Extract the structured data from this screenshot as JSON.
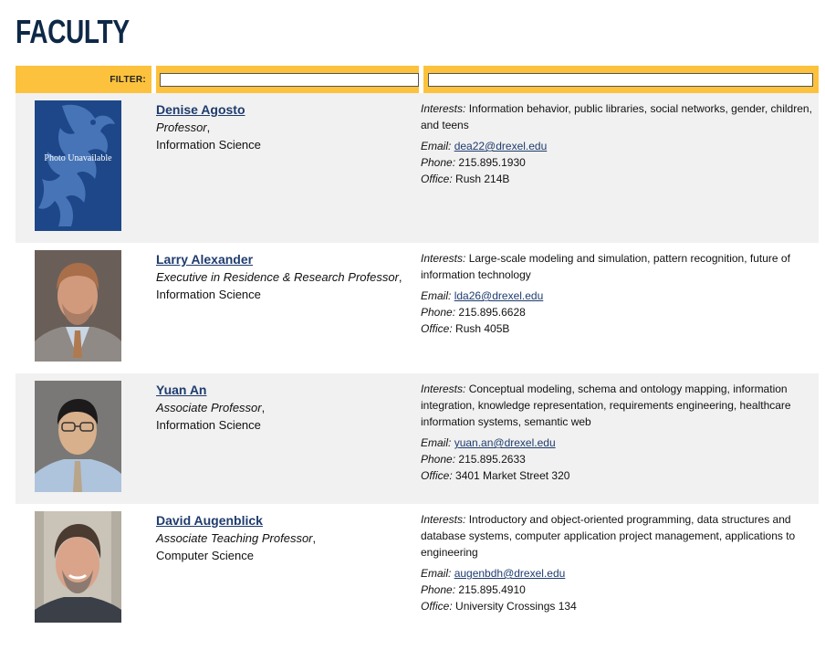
{
  "page": {
    "title": "FACULTY"
  },
  "filter": {
    "label": "FILTER:",
    "name_value": "",
    "interest_value": ""
  },
  "labels": {
    "interests": "Interests:",
    "email": "Email:",
    "phone": "Phone:",
    "office": "Office:",
    "title_separator": ","
  },
  "faculty": [
    {
      "name": "Denise Agosto",
      "title": "Professor",
      "department": "Information Science",
      "interests": "Information behavior, public libraries, social networks, gender, children, and teens",
      "email": "dea22@drexel.edu",
      "phone": "215.895.1930",
      "office": "Rush 214B",
      "photo_text": "Photo Unavailable",
      "photo_colors": {
        "bg": "#1d4788",
        "logo": "#4e7cc0"
      }
    },
    {
      "name": "Larry Alexander",
      "title": "Executive in Residence & Research Professor",
      "department": "Information Science",
      "interests": "Large-scale modeling and simulation, pattern recognition, future of information technology",
      "email": "lda26@drexel.edu",
      "phone": "215.895.6628",
      "office": "Rush 405B",
      "photo_colors": {
        "bg": "#6a5f58",
        "skin": "#d29a7c",
        "hair": "#a96f4b",
        "jacket": "#8f8a86",
        "shirt": "#c8d6e6",
        "tie": "#b07a50"
      }
    },
    {
      "name": "Yuan An",
      "title": "Associate Professor",
      "department": "Information Science",
      "interests": "Conceptual modeling, schema and ontology mapping, information integration, knowledge representation, requirements engineering, healthcare information systems, semantic web",
      "email": "yuan.an@drexel.edu",
      "phone": "215.895.2633",
      "office": "3401 Market Street 320",
      "photo_colors": {
        "bg": "#7a7876",
        "skin": "#d8b08c",
        "hair": "#1c1a1a",
        "jacket": "#8fa6c4",
        "shirt": "#aec3dc",
        "tie": "#b8a58a"
      }
    },
    {
      "name": "David Augenblick",
      "title": "Associate Teaching Professor",
      "department": "Computer Science",
      "interests": "Introductory and object-oriented programming, data structures and database systems, computer application project management, applications to engineering",
      "email": "augenbdh@drexel.edu",
      "phone": "215.895.4910",
      "office": "University Crossings 134",
      "photo_colors": {
        "bg": "#c9c3b8",
        "skin": "#d9a48a",
        "hair": "#4a3a30",
        "jacket": "#3a3f48",
        "shirt": "#e8e8e8",
        "tie": "#3a3f48"
      }
    }
  ]
}
